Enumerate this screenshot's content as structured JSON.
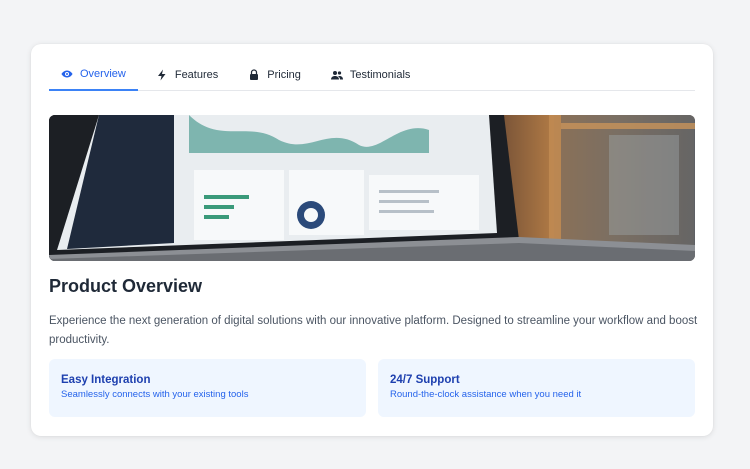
{
  "tabs": [
    {
      "label": "Overview",
      "icon": "eye-icon",
      "active": true
    },
    {
      "label": "Features",
      "icon": "lightning-icon",
      "active": false
    },
    {
      "label": "Pricing",
      "icon": "lock-icon",
      "active": false
    },
    {
      "label": "Testimonials",
      "icon": "users-icon",
      "active": false
    }
  ],
  "hero": {
    "image": "laptop-dashboard-photo"
  },
  "main": {
    "title": "Product Overview",
    "description": "Experience the next generation of digital solutions with our innovative platform. Designed to streamline your workflow and boost productivity."
  },
  "features": [
    {
      "title": "Easy Integration",
      "text": "Seamlessly connects with your existing tools"
    },
    {
      "title": "24/7 Support",
      "text": "Round-the-clock assistance when you need it"
    }
  ],
  "colors": {
    "accent": "#2563eb",
    "feature_bg": "#eff6ff",
    "heading": "#1f2937",
    "body_text": "#4b5563"
  }
}
